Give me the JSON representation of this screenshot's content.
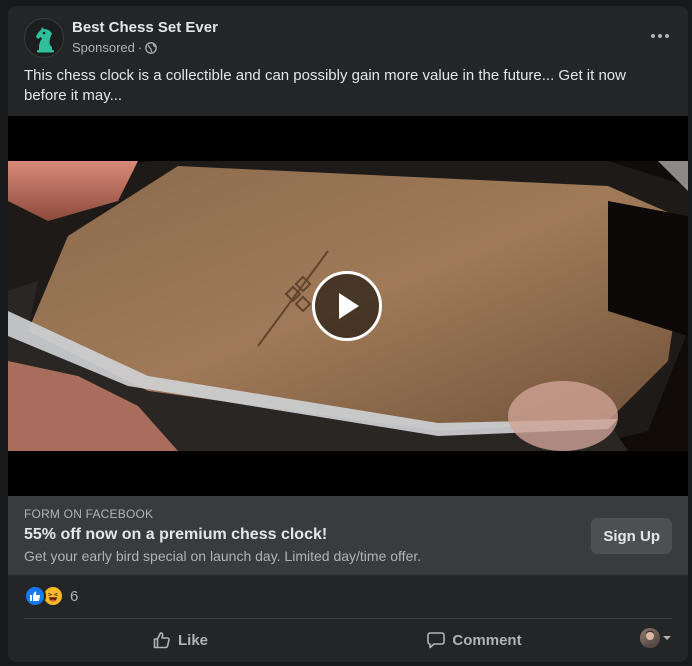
{
  "post": {
    "page_name": "Best Chess Set Ever",
    "sponsored_label": "Sponsored",
    "meta_separator": "·",
    "caption": "This chess clock is a collectible and can possibly gain more value in the future... Get it now before it may..."
  },
  "cta": {
    "label": "FORM ON FACEBOOK",
    "title": "55% off now on a premium chess clock!",
    "description": "Get your early bird special on launch day. Limited day/time offer.",
    "button_label": "Sign Up"
  },
  "reactions": {
    "count": "6",
    "types": [
      "like-icon",
      "haha-icon"
    ]
  },
  "actions": {
    "like_label": "Like",
    "comment_label": "Comment"
  },
  "colors": {
    "background": "#18191a",
    "card": "#242526",
    "cta_bg": "#3a3b3c",
    "like_blue": "#1877f2",
    "haha_yellow": "#f7b928",
    "logo_green": "#2fbf9a"
  }
}
